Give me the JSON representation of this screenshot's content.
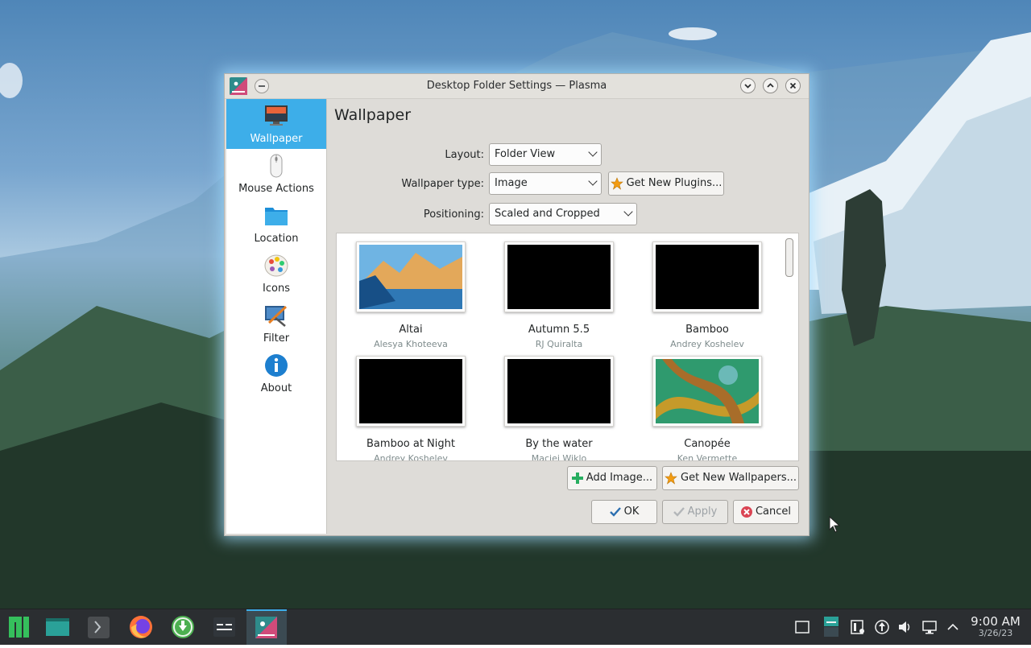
{
  "window": {
    "title": "Desktop Folder Settings — Plasma",
    "controls": [
      "minimize",
      "maximize",
      "close"
    ]
  },
  "sidebar": {
    "items": [
      {
        "label": "Wallpaper",
        "icon": "monitor-wallpaper-icon",
        "active": true
      },
      {
        "label": "Mouse Actions",
        "icon": "mouse-icon",
        "active": false
      },
      {
        "label": "Location",
        "icon": "folder-icon",
        "active": false
      },
      {
        "label": "Icons",
        "icon": "icons-palette-icon",
        "active": false
      },
      {
        "label": "Filter",
        "icon": "filter-icon",
        "active": false
      },
      {
        "label": "About",
        "icon": "info-icon",
        "active": false
      }
    ]
  },
  "main": {
    "heading": "Wallpaper",
    "layout_label": "Layout:",
    "layout_value": "Folder View",
    "type_label": "Wallpaper type:",
    "type_value": "Image",
    "get_plugins": "Get New Plugins...",
    "positioning_label": "Positioning:",
    "positioning_value": "Scaled and Cropped",
    "wallpapers": [
      {
        "name": "Altai",
        "author": "Alesya Khoteeva"
      },
      {
        "name": "Autumn 5.5",
        "author": "RJ Quiralta"
      },
      {
        "name": "Bamboo",
        "author": "Andrey Koshelev"
      },
      {
        "name": "Bamboo at Night",
        "author": "Andrey Koshelev"
      },
      {
        "name": "By the water",
        "author": "Maciej Wiklo"
      },
      {
        "name": "Canopée",
        "author": "Ken Vermette"
      }
    ],
    "add_image": "Add Image...",
    "get_wallpapers": "Get New Wallpapers..."
  },
  "buttons": {
    "ok": "OK",
    "apply": "Apply",
    "cancel": "Cancel"
  },
  "taskbar": {
    "apps": [
      "manjaro-menu-icon",
      "file-manager-icon",
      "terminal-icon",
      "firefox-icon",
      "update-download-icon",
      "system-monitor-icon",
      "plasma-settings-icon"
    ],
    "tray": [
      "show-desktop-icon",
      "storage-icon",
      "clipboard-icon",
      "updates-icon",
      "volume-icon",
      "network-icon",
      "expand-tray-icon"
    ],
    "clock_time": "9:00 AM",
    "clock_date": "3/26/23"
  },
  "colors": {
    "accent": "#3daee9",
    "window_bg": "#dedcd8",
    "taskbar_bg": "#2b2e31"
  }
}
